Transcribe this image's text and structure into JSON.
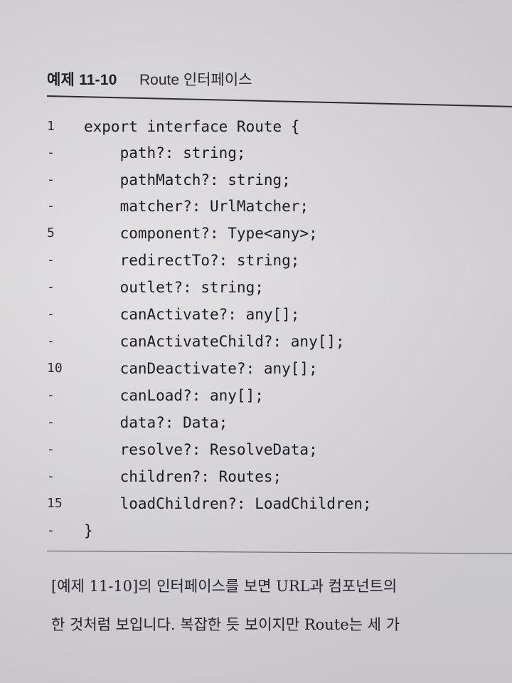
{
  "header": {
    "example_label": "예제 11-10",
    "example_title": "Route 인터페이스"
  },
  "code": {
    "lines": [
      {
        "number": "1",
        "text": "export interface Route {"
      },
      {
        "number": "-",
        "text": "    path?: string;"
      },
      {
        "number": "-",
        "text": "    pathMatch?: string;"
      },
      {
        "number": "-",
        "text": "    matcher?: UrlMatcher;"
      },
      {
        "number": "5",
        "text": "    component?: Type<any>;"
      },
      {
        "number": "-",
        "text": "    redirectTo?: string;"
      },
      {
        "number": "-",
        "text": "    outlet?: string;"
      },
      {
        "number": "-",
        "text": "    canActivate?: any[];"
      },
      {
        "number": "-",
        "text": "    canActivateChild?: any[];"
      },
      {
        "number": "10",
        "text": "    canDeactivate?: any[];"
      },
      {
        "number": "-",
        "text": "    canLoad?: any[];"
      },
      {
        "number": "-",
        "text": "    data?: Data;"
      },
      {
        "number": "-",
        "text": "    resolve?: ResolveData;"
      },
      {
        "number": "-",
        "text": "    children?: Routes;"
      },
      {
        "number": "15",
        "text": "    loadChildren?: LoadChildren;"
      },
      {
        "number": "-",
        "text": "}"
      }
    ]
  },
  "body": {
    "line1": "[예제 11-10]의 인터페이스를 보면 URL과 컴포넌트의",
    "line2": "한 것처럼 보입니다. 복잡한 듯 보이지만 Route는 세 가"
  }
}
